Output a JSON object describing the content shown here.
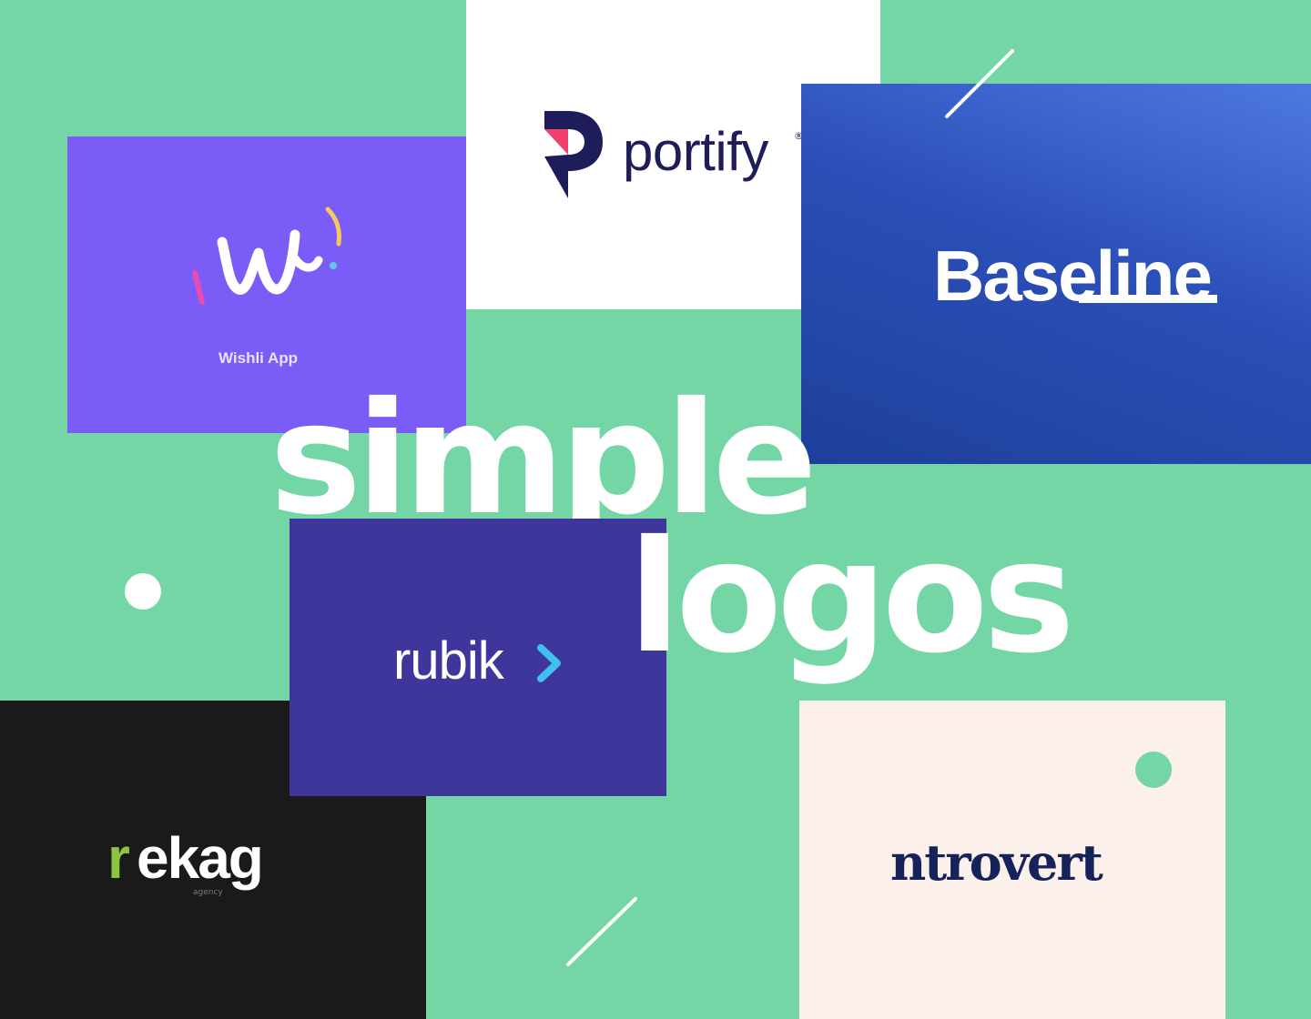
{
  "headline": {
    "line1": "simple",
    "line2": "logos"
  },
  "cards": {
    "wishli": {
      "mark_letter": "w",
      "name": "Wishli App",
      "background": "#7b5cf7"
    },
    "portify": {
      "name": "portify",
      "registered": "®",
      "background": "#ffffff",
      "text_color": "#1f1d59",
      "accent": "#f0416c"
    },
    "baseline": {
      "name": "Baseline",
      "background": "#2b4fb8"
    },
    "rubik": {
      "name": "rubik",
      "background": "#3e369a",
      "accent": "#3fc1f0"
    },
    "rekag": {
      "name_first": "r",
      "name_rest": "ekag",
      "subtitle": "agency",
      "background": "#1a1a1a",
      "accent": "#8cc63f"
    },
    "introvert": {
      "name": "ntrovert",
      "background": "#fbf1ea",
      "text_color": "#15235a"
    }
  },
  "colors": {
    "background": "#74d6a5"
  }
}
